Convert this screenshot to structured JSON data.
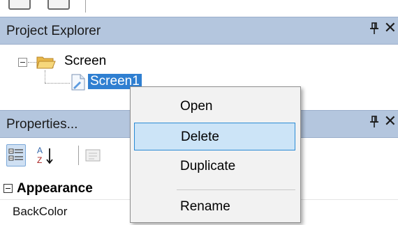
{
  "toolbar": {
    "buttons": [
      "toolbar-button-1",
      "toolbar-button-2"
    ]
  },
  "project_explorer": {
    "title": "Project Explorer",
    "pin_icon": "pin-icon",
    "close_glyph": "✕",
    "tree": {
      "root": {
        "label": "Screen",
        "icon": "folder-open-icon",
        "expanded": true
      },
      "children": [
        {
          "label": "Screen1",
          "icon": "screen-file-icon",
          "selected": true
        }
      ]
    }
  },
  "properties": {
    "title": "Properties...",
    "pin_icon": "pin-icon",
    "close_glyph": "✕",
    "toolbar": {
      "categorized_icon": "categorized-icon",
      "alphabetical_icon": "sort-alphabetical-icon",
      "property_pages_icon": "property-pages-icon"
    },
    "categories": [
      {
        "name": "Appearance",
        "expanded": true,
        "properties": [
          "BackColor"
        ]
      }
    ]
  },
  "context_menu": {
    "items": [
      {
        "label": "Open",
        "highlighted": false
      },
      {
        "label": "Delete",
        "highlighted": true
      },
      {
        "label": "Duplicate",
        "highlighted": false
      },
      {
        "label": "Rename",
        "highlighted": false
      }
    ]
  },
  "colors": {
    "panel_header": "#b4c6de",
    "selection": "#2f7fd1",
    "menu_highlight": "#cce4f7",
    "menu_highlight_border": "#2a8ad4"
  }
}
